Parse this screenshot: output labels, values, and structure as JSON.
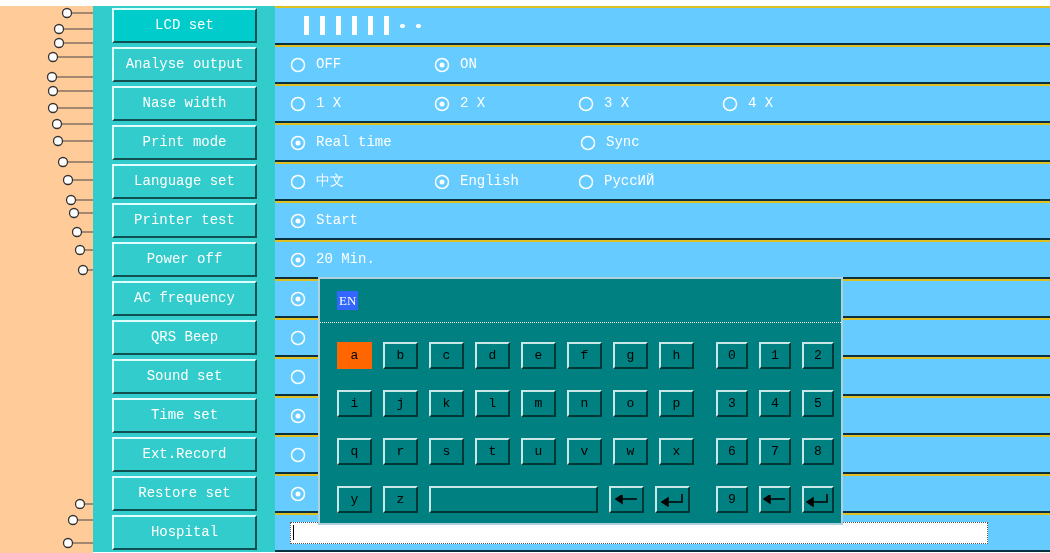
{
  "settings": [
    {
      "label": "LCD set",
      "selected": true,
      "kind": "segments",
      "segments": [
        {
          "on": true
        },
        {
          "on": true
        },
        {
          "on": true
        },
        {
          "on": true
        },
        {
          "on": true
        },
        {
          "on": true
        },
        {
          "on": false
        },
        {
          "on": false
        }
      ]
    },
    {
      "label": "Analyse output",
      "selected": false,
      "kind": "radio",
      "options": [
        {
          "label": "OFF",
          "selected": false
        },
        {
          "label": "ON",
          "selected": true
        }
      ]
    },
    {
      "label": "Nase width",
      "selected": false,
      "kind": "radio",
      "options": [
        {
          "label": "1 X",
          "selected": false
        },
        {
          "label": "2 X",
          "selected": true
        },
        {
          "label": "3 X",
          "selected": false
        },
        {
          "label": "4 X",
          "selected": false
        }
      ]
    },
    {
      "label": "Print mode",
      "selected": false,
      "kind": "radio-wide",
      "options": [
        {
          "label": "Real time",
          "selected": true
        },
        {
          "label": "Sync",
          "selected": false
        }
      ]
    },
    {
      "label": "Language set",
      "selected": false,
      "kind": "radio",
      "options": [
        {
          "label": "中文",
          "selected": false
        },
        {
          "label": "English",
          "selected": true
        },
        {
          "label": "PyccИЙ",
          "selected": false
        }
      ]
    },
    {
      "label": "Printer test",
      "selected": false,
      "kind": "radio",
      "options": [
        {
          "label": "Start",
          "selected": true
        }
      ]
    },
    {
      "label": "Power off",
      "selected": false,
      "kind": "radio",
      "options": [
        {
          "label": "20 Min.",
          "selected": true
        }
      ]
    },
    {
      "label": "AC frequency",
      "selected": false,
      "kind": "radio",
      "options": [
        {
          "selected": true
        }
      ]
    },
    {
      "label": "QRS Beep",
      "selected": false,
      "kind": "radio",
      "options": [
        {
          "selected": false
        }
      ]
    },
    {
      "label": "Sound set",
      "selected": false,
      "kind": "radio",
      "options": [
        {
          "selected": false
        }
      ]
    },
    {
      "label": "Time set",
      "selected": false,
      "kind": "radio",
      "options": [
        {
          "selected": true
        }
      ]
    },
    {
      "label": "Ext.Record",
      "selected": false,
      "kind": "radio",
      "options": [
        {
          "selected": false
        }
      ]
    },
    {
      "label": "Restore set",
      "selected": false,
      "kind": "radio",
      "options": [
        {
          "selected": true
        }
      ]
    },
    {
      "label": "Hospital",
      "selected": false,
      "kind": "input"
    }
  ],
  "keyboard": {
    "mode": "EN",
    "letter_rows": [
      [
        {
          "kind": "char",
          "label": "a",
          "selected": true
        },
        {
          "kind": "char",
          "label": "b",
          "selected": false
        },
        {
          "kind": "char",
          "label": "c",
          "selected": false
        },
        {
          "kind": "char",
          "label": "d",
          "selected": false
        },
        {
          "kind": "char",
          "label": "e",
          "selected": false
        },
        {
          "kind": "char",
          "label": "f",
          "selected": false
        },
        {
          "kind": "char",
          "label": "g",
          "selected": false
        },
        {
          "kind": "char",
          "label": "h",
          "selected": false
        }
      ],
      [
        {
          "kind": "char",
          "label": "i",
          "selected": false
        },
        {
          "kind": "char",
          "label": "j",
          "selected": false
        },
        {
          "kind": "char",
          "label": "k",
          "selected": false
        },
        {
          "kind": "char",
          "label": "l",
          "selected": false
        },
        {
          "kind": "char",
          "label": "m",
          "selected": false
        },
        {
          "kind": "char",
          "label": "n",
          "selected": false
        },
        {
          "kind": "char",
          "label": "o",
          "selected": false
        },
        {
          "kind": "char",
          "label": "p",
          "selected": false
        }
      ],
      [
        {
          "kind": "char",
          "label": "q",
          "selected": false
        },
        {
          "kind": "char",
          "label": "r",
          "selected": false
        },
        {
          "kind": "char",
          "label": "s",
          "selected": false
        },
        {
          "kind": "char",
          "label": "t",
          "selected": false
        },
        {
          "kind": "char",
          "label": "u",
          "selected": false
        },
        {
          "kind": "char",
          "label": "v",
          "selected": false
        },
        {
          "kind": "char",
          "label": "w",
          "selected": false
        },
        {
          "kind": "char",
          "label": "x",
          "selected": false
        }
      ],
      [
        {
          "kind": "char",
          "label": "y",
          "selected": false
        },
        {
          "kind": "char",
          "label": "z",
          "selected": false
        },
        {
          "kind": "space",
          "selected": false
        },
        {
          "kind": "backspace",
          "selected": false
        },
        {
          "kind": "enter",
          "selected": false
        }
      ]
    ],
    "digit_rows": [
      [
        {
          "kind": "char",
          "label": "0",
          "selected": false
        },
        {
          "kind": "char",
          "label": "1",
          "selected": false
        },
        {
          "kind": "char",
          "label": "2",
          "selected": false
        }
      ],
      [
        {
          "kind": "char",
          "label": "3",
          "selected": false
        },
        {
          "kind": "char",
          "label": "4",
          "selected": false
        },
        {
          "kind": "char",
          "label": "5",
          "selected": false
        }
      ],
      [
        {
          "kind": "char",
          "label": "6",
          "selected": false
        },
        {
          "kind": "char",
          "label": "7",
          "selected": false
        },
        {
          "kind": "char",
          "label": "8",
          "selected": false
        }
      ],
      [
        {
          "kind": "char",
          "label": "9",
          "selected": false
        },
        {
          "kind": "backspace",
          "selected": false
        },
        {
          "kind": "enter",
          "selected": false
        }
      ]
    ]
  }
}
